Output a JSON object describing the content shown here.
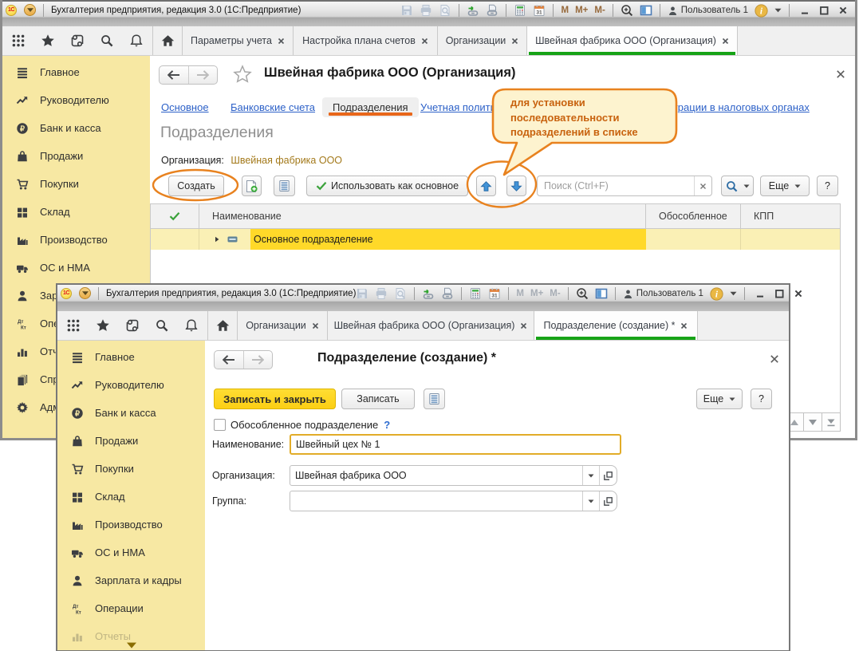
{
  "app": {
    "window_title": "Бухгалтерия предприятия, редакция 3.0  (1С:Предприятие)",
    "logo": "1С",
    "user": "Пользователь 1",
    "memory": {
      "m": "M",
      "m_plus": "M+",
      "m_minus": "M-"
    },
    "calendar_day": "31"
  },
  "back_window": {
    "tabs": [
      {
        "label": "Параметры учета"
      },
      {
        "label": "Настройка плана счетов"
      },
      {
        "label": "Организации"
      },
      {
        "label": "Швейная фабрика ООО (Организация)"
      }
    ],
    "sidebar": [
      {
        "label": "Главное"
      },
      {
        "label": "Руководителю"
      },
      {
        "label": "Банк и касса"
      },
      {
        "label": "Продажи"
      },
      {
        "label": "Покупки"
      },
      {
        "label": "Склад"
      },
      {
        "label": "Производство"
      },
      {
        "label": "ОС и НМА"
      },
      {
        "label": "Зарплата и кадры"
      },
      {
        "label": "Операции"
      },
      {
        "label": "Отчеты"
      },
      {
        "label": "Справочники"
      },
      {
        "label": "Администрирование"
      }
    ],
    "page": {
      "title": "Швейная фабрика ООО (Организация)",
      "nav": [
        {
          "label": "Основное"
        },
        {
          "label": "Банковские счета"
        },
        {
          "label": "Подразделения"
        },
        {
          "label": "Учетная политика"
        },
        {
          "label": "Регистрации в налоговых органах"
        }
      ],
      "heading": "Подразделения",
      "org_label": "Организация:",
      "org_value": "Швейная фабрика ООО",
      "create_button": "Создать",
      "use_as_main_button": "Использовать как основное",
      "search_placeholder": "Поиск (Ctrl+F)",
      "more_button": "Еще",
      "help_button": "?",
      "callout": "для установки последовательности подразделений в списке",
      "table": {
        "columns": [
          "Наименование",
          "Обособленное",
          "КПП"
        ],
        "rows": [
          {
            "name": "Основное подразделение",
            "separate": "",
            "kpp": ""
          }
        ]
      }
    }
  },
  "front_window": {
    "tabs": [
      {
        "label": "Организации"
      },
      {
        "label": "Швейная фабрика ООО (Организация)"
      },
      {
        "label": "Подразделение (создание) *"
      }
    ],
    "sidebar": [
      {
        "label": "Главное"
      },
      {
        "label": "Руководителю"
      },
      {
        "label": "Банк и касса"
      },
      {
        "label": "Продажи"
      },
      {
        "label": "Покупки"
      },
      {
        "label": "Склад"
      },
      {
        "label": "Производство"
      },
      {
        "label": "ОС и НМА"
      },
      {
        "label": "Зарплата и кадры"
      },
      {
        "label": "Операции"
      },
      {
        "label": "Отчеты"
      }
    ],
    "form": {
      "title": "Подразделение (создание) *",
      "save_close_button": "Записать и закрыть",
      "save_button": "Записать",
      "more_button": "Еще",
      "help_button": "?",
      "separate_checkbox_label": "Обособленное подразделение",
      "checkbox_help_mark": "?",
      "fields": [
        {
          "label": "Наименование:",
          "value": "Швейный цех № 1"
        },
        {
          "label": "Организация:",
          "value": "Швейная фабрика ООО"
        },
        {
          "label": "Группа:",
          "value": ""
        }
      ]
    }
  }
}
